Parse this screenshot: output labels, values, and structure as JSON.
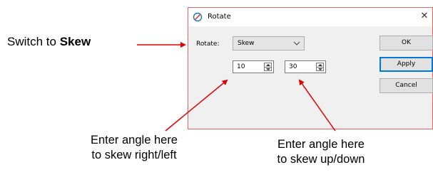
{
  "annotations": {
    "switch_prefix": "Switch to ",
    "switch_bold": "Skew",
    "left_line1": "Enter angle here",
    "left_line2": "to skew right/left",
    "right_line1": "Enter angle here",
    "right_line2": "to skew up/down",
    "arrow_color": "#e00000"
  },
  "dialog": {
    "title": "Rotate",
    "close_glyph": "✕",
    "rotate_label": "Rotate:",
    "mode_select": {
      "selected": "Skew"
    },
    "skew_horizontal_value": "10",
    "skew_vertical_value": "30",
    "buttons": {
      "ok": "OK",
      "apply": "Apply",
      "cancel": "Cancel"
    },
    "border_color": "#e06666",
    "accent_color": "#0078d7"
  }
}
